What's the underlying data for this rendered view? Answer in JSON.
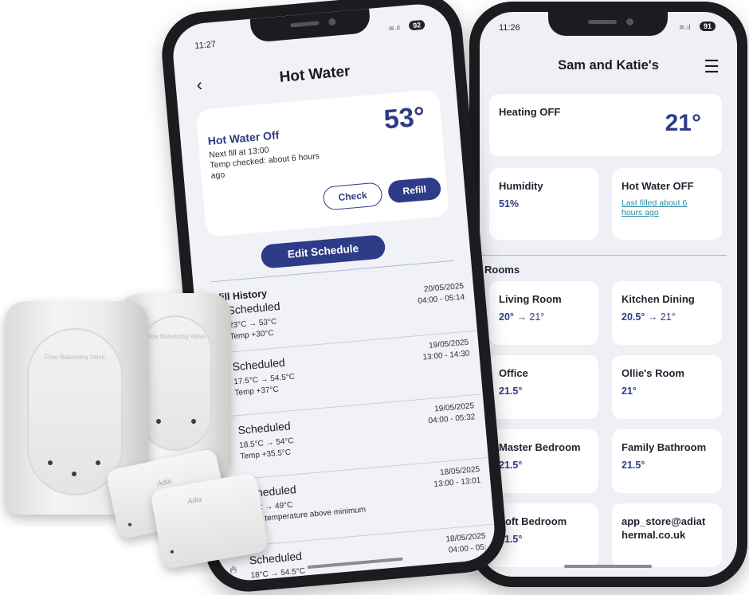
{
  "left_phone": {
    "status_time": "11:27",
    "battery": "92",
    "title": "Hot Water",
    "back_icon": "chevron-left-icon",
    "summary": {
      "status": "Hot Water Off",
      "temperature": "53°",
      "next_fill": "Next fill at 13:00",
      "checked": "Temp checked: about 6 hours ago",
      "check_label": "Check",
      "refill_label": "Refill"
    },
    "edit_schedule_label": "Edit Schedule",
    "history_title": "Refill History",
    "history": [
      {
        "icon": "flame-icon",
        "kind": "Scheduled",
        "temps": "23°C → 53°C",
        "note": "Temp +30°C",
        "date": "20/05/2025",
        "time": "04:00 - 05:14"
      },
      {
        "icon": "flame-icon",
        "kind": "Scheduled",
        "temps": "17.5°C → 54.5°C",
        "note": "Temp +37°C",
        "date": "19/05/2025",
        "time": "13:00 - 14:30"
      },
      {
        "icon": "flame-icon",
        "kind": "Scheduled",
        "temps": "18.5°C → 54°C",
        "note": "Temp +35.5°C",
        "date": "19/05/2025",
        "time": "04:00 - 05:32"
      },
      {
        "icon": "arrow-right-icon",
        "kind": "Scheduled",
        "temps": "49°C → 49°C",
        "note": "Tank temperature above minimum",
        "date": "18/05/2025",
        "time": "13:00 - 13:01"
      },
      {
        "icon": "flame-icon",
        "kind": "Scheduled",
        "temps": "18°C → 54.5°C",
        "note": "Temp +36.5°C",
        "date": "18/05/2025",
        "time": "04:00 - 05:"
      }
    ]
  },
  "right_phone": {
    "status_time": "11:26",
    "battery": "91",
    "title": "Sam and Katie's",
    "menu_icon": "hamburger-menu-icon",
    "heating": {
      "label": "Heating OFF",
      "temp": "21°"
    },
    "humidity": {
      "label": "Humidity",
      "value": "51%"
    },
    "hot_water": {
      "label": "Hot Water OFF",
      "link": "Last filled about 6 hours ago"
    },
    "rooms_title": "Rooms",
    "rooms": [
      {
        "name": "Living Room",
        "temp": "20°",
        "target": "→ 21°"
      },
      {
        "name": "Kitchen Dining",
        "temp": "20.5°",
        "target": "→ 21°"
      },
      {
        "name": "Office",
        "temp": "21.5°",
        "target": ""
      },
      {
        "name": "Ollie's Room",
        "temp": "21°",
        "target": ""
      },
      {
        "name": "Master Bedroom",
        "temp": "21.5°",
        "target": ""
      },
      {
        "name": "Family Bathroom",
        "temp": "21.5°",
        "target": ""
      },
      {
        "name": "Loft Bedroom",
        "temp": "21.5°",
        "target": ""
      },
      {
        "name": "app_store@adiathermal.co.uk",
        "temp": "",
        "target": ""
      }
    ]
  },
  "hardware": {
    "valve_print": "Flow Balancing Valve",
    "sensor_brand": "Adia"
  },
  "colors": {
    "accent": "#2e3c88",
    "link": "#2e8aa6",
    "background": "#eef0f5"
  }
}
